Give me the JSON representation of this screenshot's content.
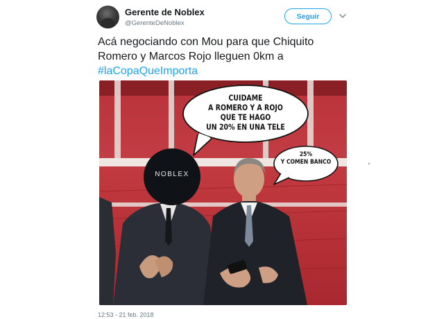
{
  "author": {
    "display_name": "Gerente de Noblex",
    "handle": "@GerenteDeNoblex"
  },
  "follow_button_label": "Seguir",
  "tweet": {
    "lines": [
      "Acá negociando con Mou para que Chiquito",
      "Romero y Marcos Rojo lleguen 0km a"
    ],
    "hashtag": "#laCopaQueImporta",
    "timestamp": "12:53 - 21 feb. 2018"
  },
  "media": {
    "bubble_main": {
      "lines": [
        "CUIDAME",
        "A ROMERO Y A ROJO",
        "QUE TE HAGO",
        "UN 20% EN UNA TELE"
      ]
    },
    "bubble_reply": {
      "lines": [
        "25%",
        "Y COMEN BANCO"
      ]
    },
    "logo_text": "NOBLEX"
  },
  "colors": {
    "accent": "#1da1f2",
    "text": "#14171a",
    "secondary_text": "#657786",
    "stadium_seats": "#c23a3f"
  },
  "icons": {
    "dropdown": "chevron-down-icon"
  }
}
